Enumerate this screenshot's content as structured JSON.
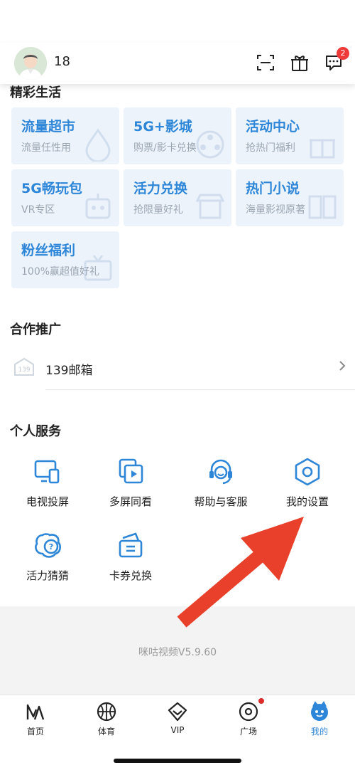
{
  "header": {
    "username": "18",
    "notification_count": "2",
    "icons": [
      "scan-icon",
      "gift-icon",
      "message-icon"
    ]
  },
  "sections": {
    "life": {
      "title": "精彩生活",
      "tiles": [
        {
          "title": "流量超市",
          "subtitle": "流量任性用"
        },
        {
          "title": "5G+影城",
          "subtitle": "购票/影卡兑换"
        },
        {
          "title": "活动中心",
          "subtitle": "抢热门福利"
        },
        {
          "title": "5G畅玩包",
          "subtitle": "VR专区"
        },
        {
          "title": "活力兑换",
          "subtitle": "抢限量好礼"
        },
        {
          "title": "热门小说",
          "subtitle": "海量影视原著"
        },
        {
          "title": "粉丝福利",
          "subtitle": "100%赢超值好礼"
        }
      ]
    },
    "promo": {
      "title": "合作推广",
      "items": [
        {
          "label": "139邮箱"
        }
      ]
    },
    "personal": {
      "title": "个人服务",
      "items": [
        {
          "label": "电视投屏"
        },
        {
          "label": "多屏同看"
        },
        {
          "label": "帮助与客服"
        },
        {
          "label": "我的设置"
        },
        {
          "label": "活力猜猜"
        },
        {
          "label": "卡券兑换"
        }
      ]
    }
  },
  "footer": {
    "version": "咪咕视频V5.9.60"
  },
  "tabbar": {
    "items": [
      {
        "label": "首页"
      },
      {
        "label": "体育"
      },
      {
        "label": "VIP"
      },
      {
        "label": "广场"
      },
      {
        "label": "我的"
      }
    ],
    "active": "我的"
  },
  "colors": {
    "accent": "#2d86d8",
    "tile_bg": "#edf3fb",
    "badge": "#f03a3a",
    "arrow": "#e8402a"
  }
}
